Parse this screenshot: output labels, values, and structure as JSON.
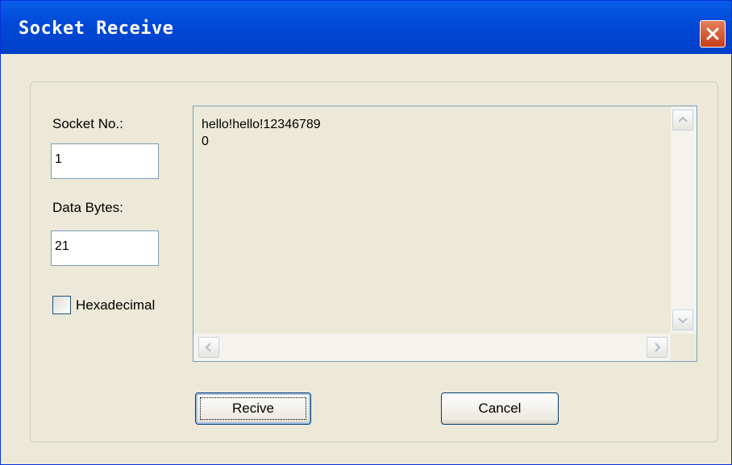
{
  "window": {
    "title": "Socket Receive"
  },
  "form": {
    "socket_no_label": "Socket No.:",
    "socket_no_value": "1",
    "data_bytes_label": "Data Bytes:",
    "data_bytes_value": "21",
    "hex_label": "Hexadecimal",
    "hex_checked": false
  },
  "memo": {
    "text": "hello!hello!12346789\n0"
  },
  "buttons": {
    "receive_label": "Recive",
    "cancel_label": "Cancel"
  },
  "colors": {
    "titlebar": "#0048d6",
    "dialog_bg": "#ece9d8",
    "close_button": "#c73d19"
  }
}
